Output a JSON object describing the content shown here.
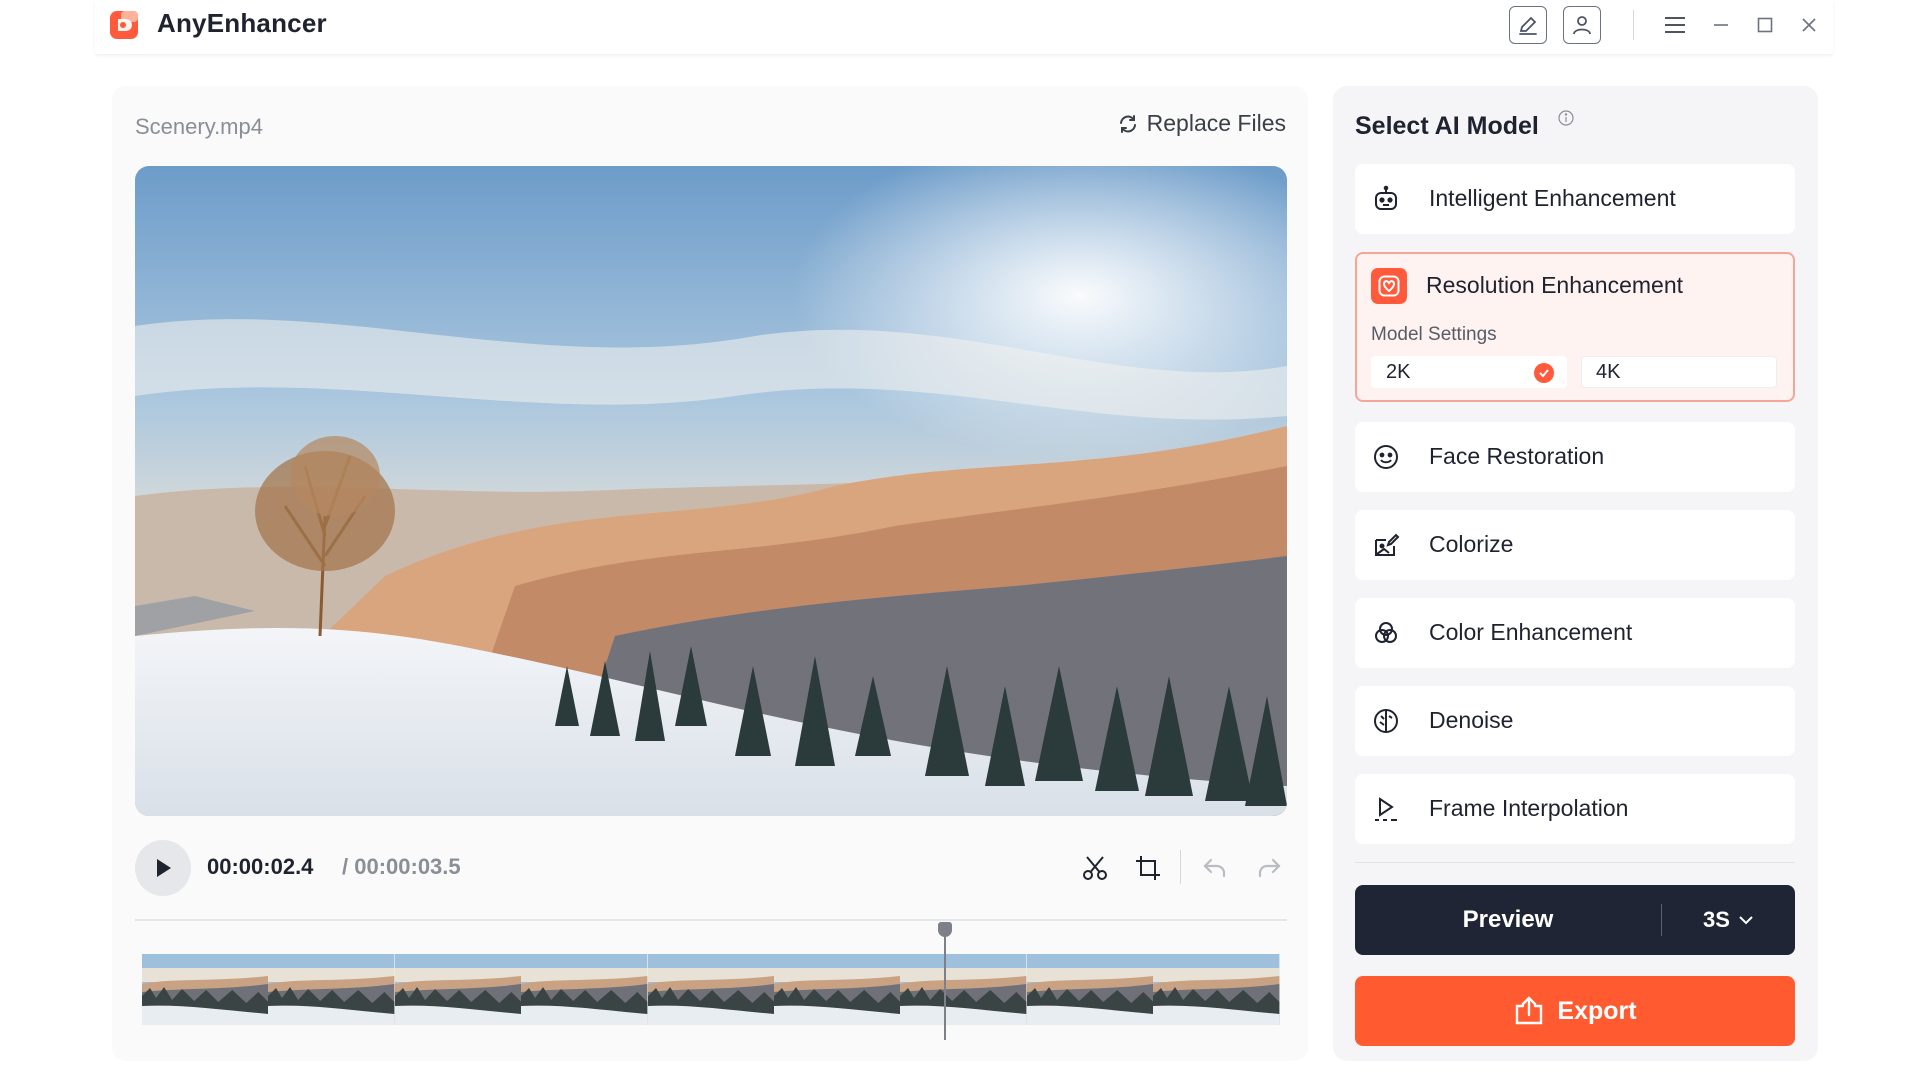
{
  "app": {
    "title": "AnyEnhancer"
  },
  "editor": {
    "file_name": "Scenery.mp4",
    "replace_files_label": "Replace Files",
    "time_current": "00:00:02.4",
    "time_total": "/ 00:00:03.5",
    "frame_count": 9
  },
  "models": {
    "title": "Select AI Model",
    "items": [
      {
        "label": "Intelligent Enhancement",
        "icon": "robot-icon"
      },
      {
        "label": "Resolution Enhancement",
        "icon": "resolution-icon",
        "active": true
      },
      {
        "label": "Face Restoration",
        "icon": "face-icon"
      },
      {
        "label": "Colorize",
        "icon": "colorize-icon"
      },
      {
        "label": "Color Enhancement",
        "icon": "color-enhance-icon"
      },
      {
        "label": "Denoise",
        "icon": "denoise-icon"
      },
      {
        "label": "Frame Interpolation",
        "icon": "frame-interpolation-icon"
      }
    ],
    "settings_label": "Model Settings",
    "resolution_options": [
      "2K",
      "4K"
    ],
    "selected_resolution": "2K"
  },
  "actions": {
    "preview_label": "Preview",
    "preview_duration": "3S",
    "export_label": "Export"
  },
  "colors": {
    "accent": "#ff5a30",
    "dark": "#1f2535"
  }
}
